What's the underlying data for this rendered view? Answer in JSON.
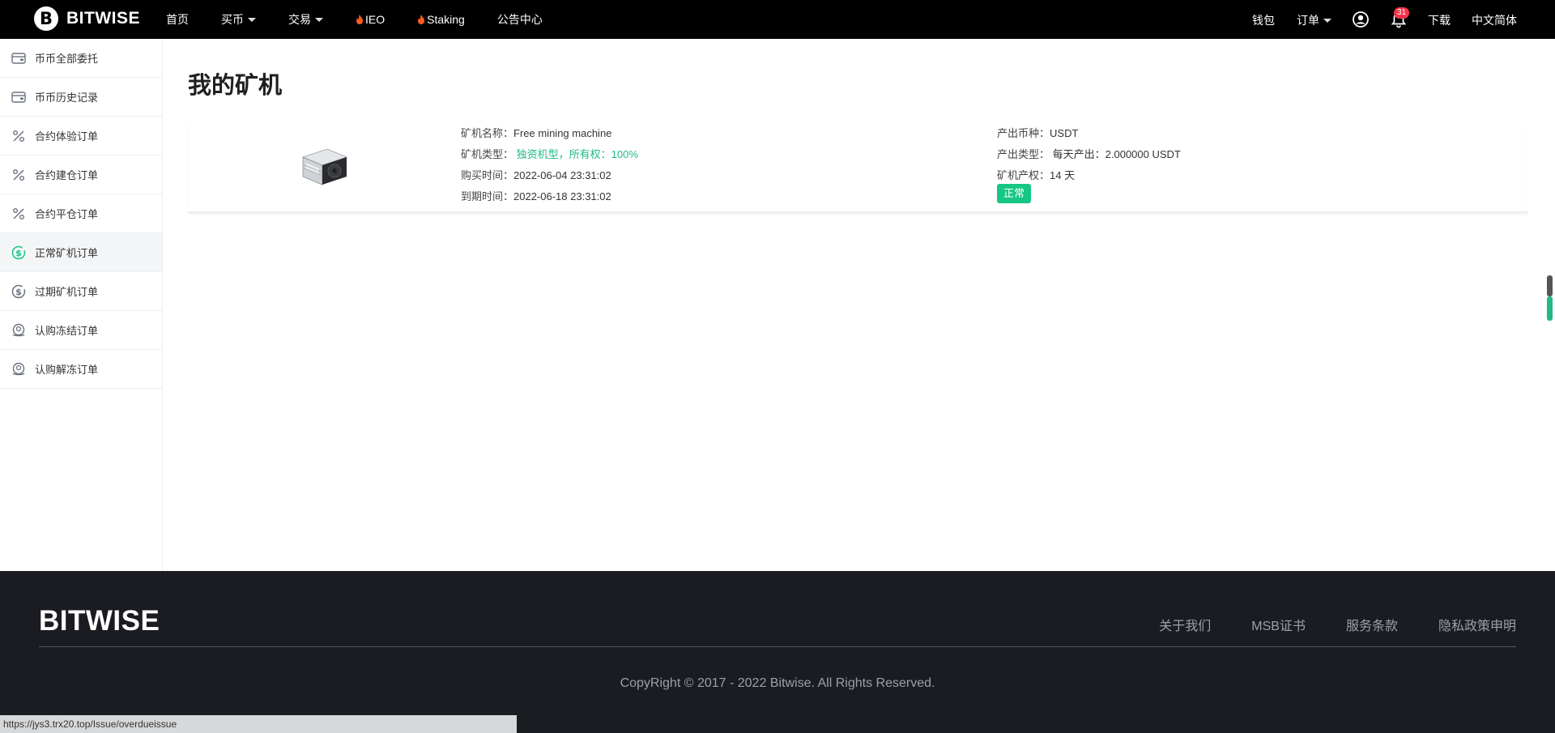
{
  "header": {
    "logo_text": "BITWISE",
    "logo_letter": "B",
    "nav": [
      {
        "label": "首页"
      },
      {
        "label": "买币"
      },
      {
        "label": "交易"
      },
      {
        "label": "IEO"
      },
      {
        "label": "Staking"
      },
      {
        "label": "公告中心"
      }
    ],
    "right": {
      "wallet": "钱包",
      "orders": "订单",
      "notification_count": "31",
      "download": "下载",
      "language": "中文简体"
    }
  },
  "sidebar": {
    "items": [
      {
        "label": "币币全部委托",
        "icon": "wallet-icon"
      },
      {
        "label": "币币历史记录",
        "icon": "wallet-icon"
      },
      {
        "label": "合约体验订单",
        "icon": "percent-icon"
      },
      {
        "label": "合约建仓订单",
        "icon": "percent-icon"
      },
      {
        "label": "合约平仓订单",
        "icon": "percent-icon"
      },
      {
        "label": "正常矿机订单",
        "icon": "dollar-coin-icon"
      },
      {
        "label": "过期矿机订单",
        "icon": "dollar-coin-icon"
      },
      {
        "label": "认购冻结订单",
        "icon": "coin-hand-icon"
      },
      {
        "label": "认购解冻订单",
        "icon": "coin-hand-icon"
      }
    ],
    "active_index": 5
  },
  "main": {
    "title": "我的矿机",
    "machine": {
      "name_label": "矿机名称：",
      "name": "Free mining machine",
      "type_label": "矿机类型：",
      "type": "独资机型，所有权：100%",
      "buy_time_label": "购买时间：",
      "buy_time": "2022-06-04 23:31:02",
      "expire_time_label": "到期时间：",
      "expire_time": "2022-06-18 23:31:02",
      "coin_label": "产出币种：",
      "coin": "USDT",
      "output_type_label": "产出类型：",
      "output_type": "每天产出：2.000000 USDT",
      "term_label": "矿机产权：",
      "term": "14 天",
      "status": "正常"
    }
  },
  "footer": {
    "logo": "BITWISE",
    "links": [
      "关于我们",
      "MSB证书",
      "服务条款",
      "隐私政策申明"
    ],
    "copyright": "CopyRight © 2017 - 2022 Bitwise. All Rights Reserved."
  },
  "status_bar_url": "https://jys3.trx20.top/Issue/overdueissue",
  "colors": {
    "accent_green": "#16c784",
    "header_bg": "#000000",
    "footer_bg": "#1b1c21",
    "badge_red": "#f5334b"
  }
}
